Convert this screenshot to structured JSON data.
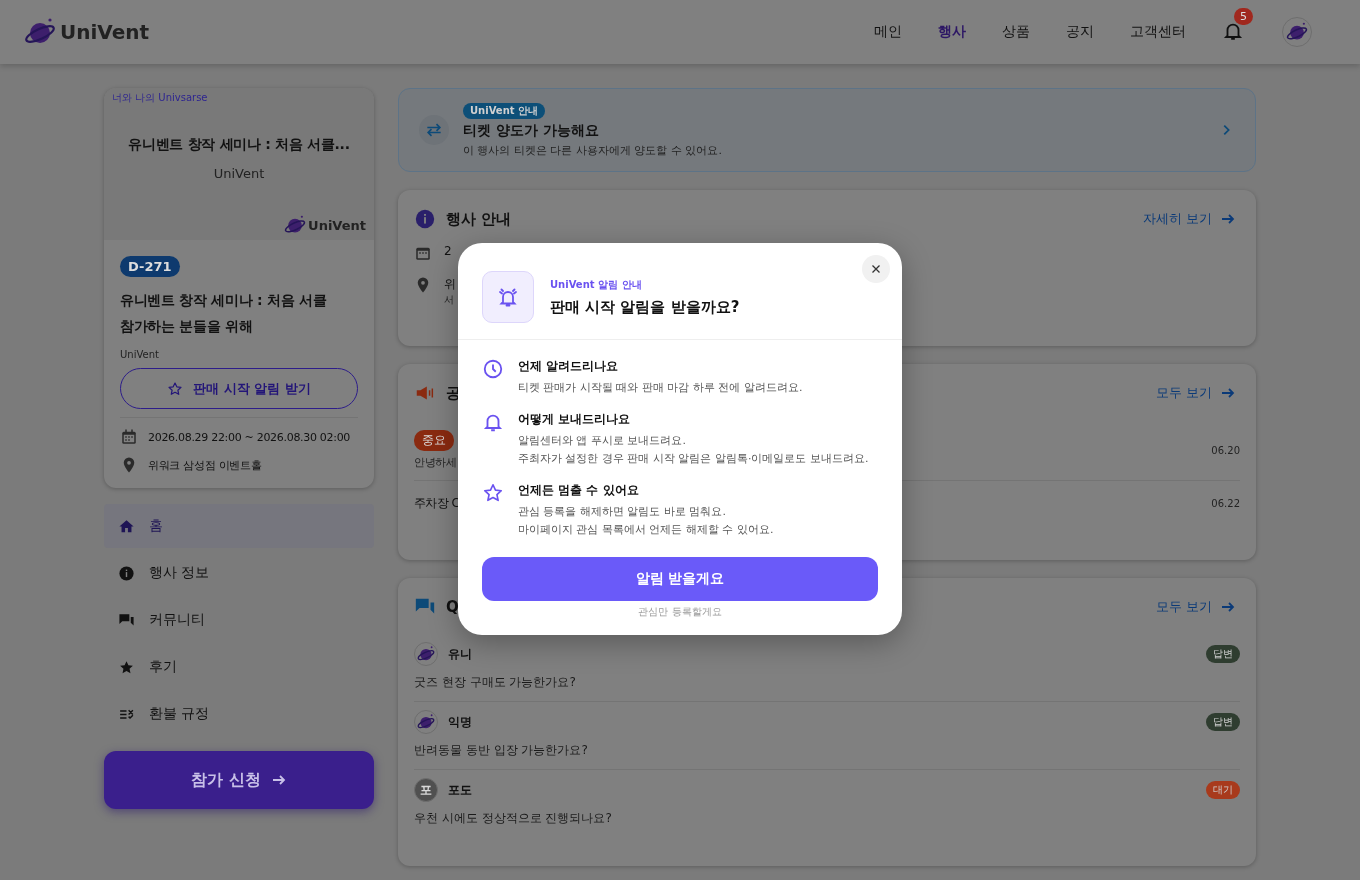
{
  "header": {
    "logo": "UniVent",
    "nav": [
      {
        "label": "메인",
        "selected": false
      },
      {
        "label": "행사",
        "selected": true
      },
      {
        "label": "상품",
        "selected": false
      },
      {
        "label": "공지",
        "selected": false
      },
      {
        "label": "고객센터",
        "selected": false
      }
    ],
    "notification_count": "5"
  },
  "event_card": {
    "poster": {
      "tagline": "너와 나의 Univsarse",
      "title": "유니벤트 창작 세미나 : 처음 서클...",
      "host": "UniVent",
      "logo": "UniVent"
    },
    "dday": "D-271",
    "title": "유니벤트 창작 세미나 : 처음 서클 참가하는 분들을 위해",
    "organizer": "UniVent",
    "alert_button": "판매 시작 알림 받기",
    "date": "2026.08.29 22:00 ~ 2026.08.30 02:00",
    "place": "위워크 삼성점 이벤트홀"
  },
  "sidebar": {
    "items": [
      {
        "label": "홈",
        "kind": "home",
        "selected": true
      },
      {
        "label": "행사 정보",
        "kind": "info",
        "selected": false
      },
      {
        "label": "커뮤니티",
        "kind": "chat",
        "selected": false
      },
      {
        "label": "후기",
        "kind": "star",
        "selected": false
      },
      {
        "label": "환불 규정",
        "kind": "rules",
        "selected": false
      }
    ],
    "apply_button": "참가 신청"
  },
  "transfer_banner": {
    "badge": "UniVent 안내",
    "title": "티켓 양도가 가능해요",
    "subtitle": "이 행사의 티켓은 다른 사용자에게 양도할 수 있어요."
  },
  "event_info": {
    "title": "행사 안내",
    "link": "자세히 보기",
    "rows": [
      {
        "kind": "date",
        "text": "2"
      },
      {
        "kind": "place",
        "text": "위",
        "sub": "서"
      }
    ]
  },
  "notices": {
    "title": "공",
    "link": "모두 보기",
    "items": [
      {
        "tag": "중요",
        "text": "안녕하세",
        "date": "06.20"
      },
      {
        "title": "주차장 C",
        "date": "06.22"
      }
    ]
  },
  "qna": {
    "title": "Q",
    "link": "모두 보기",
    "items": [
      {
        "author": "유니",
        "kind": "logo",
        "question": "굿즈 현장 구매도 가능한가요?",
        "status": "답변",
        "color": "#2f3d30"
      },
      {
        "author": "익명",
        "kind": "logo",
        "question": "반려동물 동반 입장 가능한가요?",
        "status": "답변",
        "color": "#2f3d30"
      },
      {
        "author": "포도",
        "kind": "letter",
        "letter": "포",
        "question": "우천 시에도 정상적으로 진행되나요?",
        "status": "대기",
        "color": "#a83a1c"
      }
    ]
  },
  "modal": {
    "eyebrow": "UniVent 알림 안내",
    "title": "판매 시작 알림을 받을까요?",
    "items": [
      {
        "kind": "clock",
        "title": "언제 알려드리나요",
        "lines": [
          "티켓 판매가 시작될 때와 판매 마감 하루 전에 알려드려요."
        ]
      },
      {
        "kind": "bell",
        "title": "어떻게 보내드리나요",
        "lines": [
          "알림센터와 앱 푸시로 보내드려요.",
          "주최자가 설정한 경우 판매 시작 알림은 알림톡·이메일로도 보내드려요."
        ]
      },
      {
        "kind": "star",
        "title": "언제든 멈출 수 있어요",
        "lines": [
          "관심 등록을 해제하면 알림도 바로 멈춰요.",
          "마이페이지 관심 목록에서 언제든 해제할 수 있어요."
        ]
      }
    ],
    "primary_button": "알림 받을게요",
    "secondary_link": "관심만 등록할게요"
  }
}
